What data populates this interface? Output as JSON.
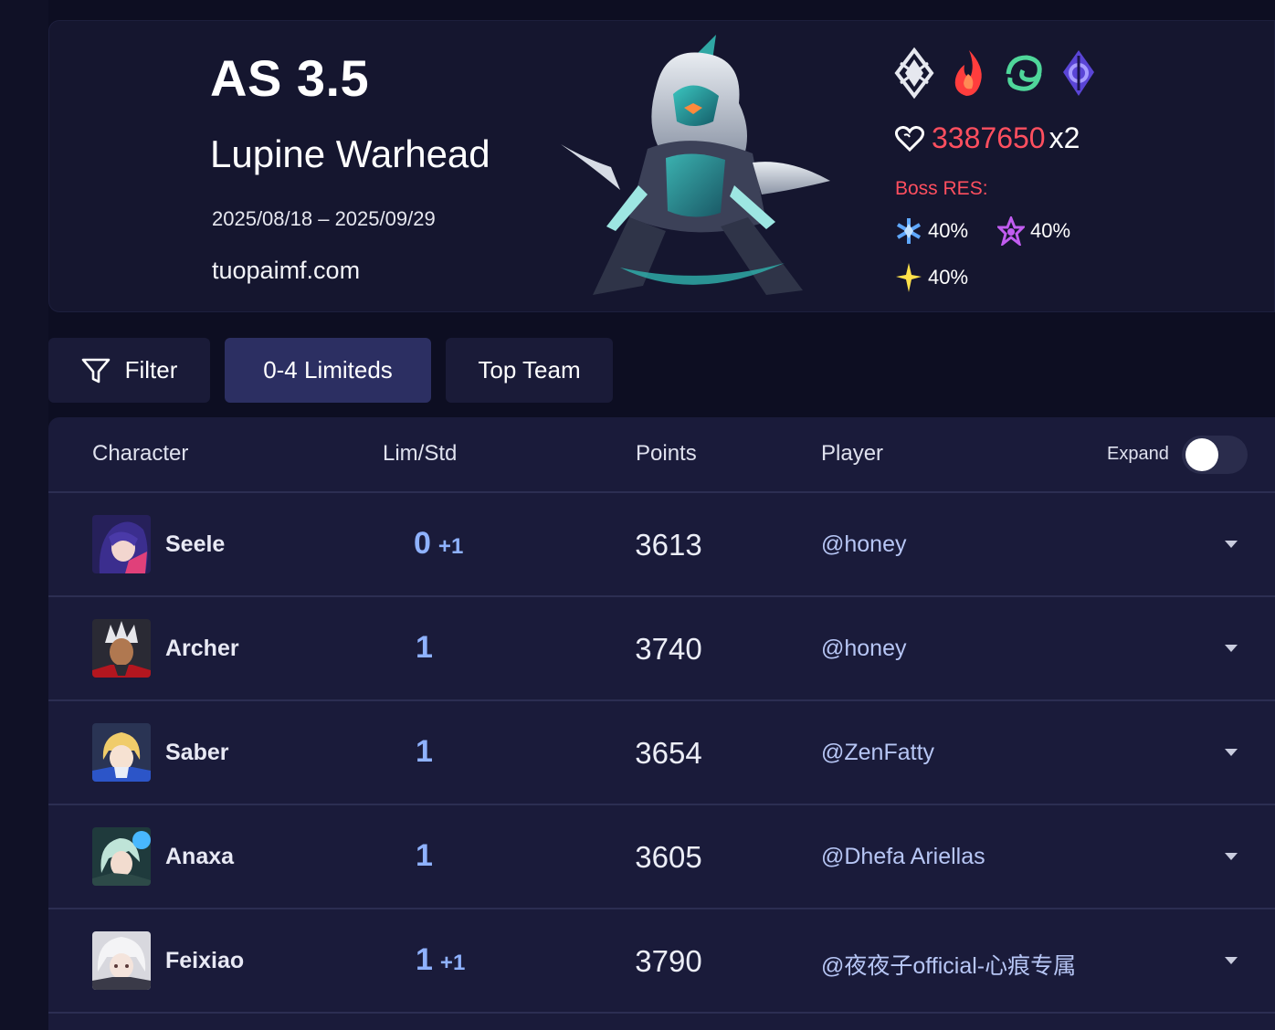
{
  "banner": {
    "title": "AS 3.5",
    "boss_name": "Lupine Warhead",
    "dates": "2025/08/18 – 2025/09/29",
    "site": "tuopaimf.com",
    "elements": [
      "physical-icon",
      "fire-icon",
      "wind-icon",
      "quantum-icon"
    ],
    "hp_value": "3387650",
    "hp_multiplier": "x2",
    "res_label": "Boss RES:",
    "res": [
      {
        "element": "ice-icon",
        "value": "40%"
      },
      {
        "element": "imaginary-icon",
        "value": "40%"
      },
      {
        "element": "lightning-icon",
        "value": "40%"
      }
    ]
  },
  "toolbar": {
    "filter_label": "Filter",
    "limited_label": "0-4 Limiteds",
    "top_team_label": "Top Team"
  },
  "table": {
    "headers": {
      "character": "Character",
      "lim_std": "Lim/Std",
      "points": "Points",
      "player": "Player",
      "expand": "Expand"
    },
    "expand_on": false,
    "rows": [
      {
        "character": "Seele",
        "lim": "0",
        "extra": "+1",
        "points": "3613",
        "player": "@honey"
      },
      {
        "character": "Archer",
        "lim": "1",
        "extra": "",
        "points": "3740",
        "player": "@honey"
      },
      {
        "character": "Saber",
        "lim": "1",
        "extra": "",
        "points": "3654",
        "player": "@ZenFatty"
      },
      {
        "character": "Anaxa",
        "lim": "1",
        "extra": "",
        "points": "3605",
        "player": "@Dhefa Ariellas"
      },
      {
        "character": "Feixiao",
        "lim": "1",
        "extra": "+1",
        "points": "3790",
        "player": "@夜夜子official-心痕专属"
      }
    ]
  },
  "colors": {
    "background": "#0d0e22",
    "panel": "#15162f",
    "table_bg": "#1a1b3a",
    "accent_blue": "#8fb2ff",
    "hp_red": "#ff4f5f"
  }
}
